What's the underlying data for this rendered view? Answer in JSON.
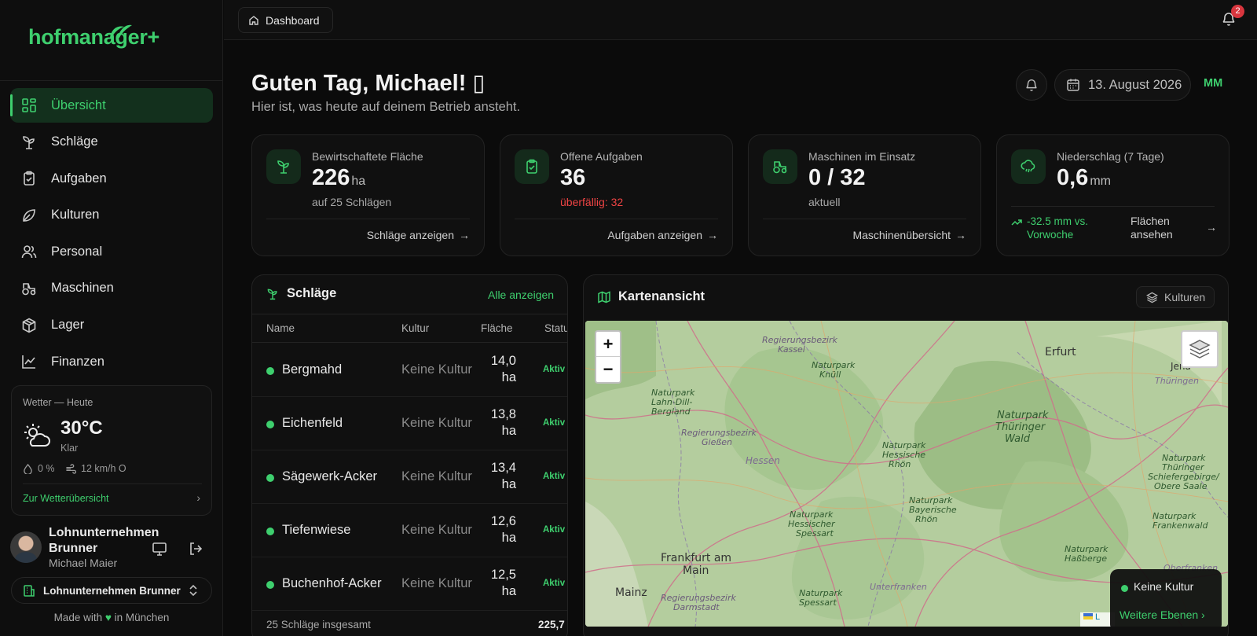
{
  "brand": {
    "name": "hofmanager+",
    "color": "#3ecf6e"
  },
  "nav": [
    {
      "label": "Übersicht",
      "icon": "grid-icon",
      "active": true
    },
    {
      "label": "Schläge",
      "icon": "sprout-icon"
    },
    {
      "label": "Aufgaben",
      "icon": "clipboard-icon"
    },
    {
      "label": "Kulturen",
      "icon": "leaf-icon"
    },
    {
      "label": "Personal",
      "icon": "users-icon"
    },
    {
      "label": "Maschinen",
      "icon": "tractor-icon"
    },
    {
      "label": "Lager",
      "icon": "package-icon"
    },
    {
      "label": "Finanzen",
      "icon": "chart-line-icon"
    }
  ],
  "weather": {
    "title": "Wetter — Heute",
    "temp": "30°C",
    "condition": "Klar",
    "rain": "0 %",
    "wind": "12 km/h O",
    "link": "Zur Wetterübersicht"
  },
  "user": {
    "org": "Lohnunternehmen Brunner",
    "name": "Michael Maier"
  },
  "org_switch": {
    "label": "Lohnunternehmen Brunner"
  },
  "footer": {
    "prefix": "Made with",
    "heart": "♥",
    "suffix": "in München"
  },
  "topbar": {
    "breadcrumb": "Dashboard",
    "notifications": "2"
  },
  "header": {
    "greeting": "Guten Tag, Michael! ",
    "greeting_glyph": "▯",
    "subtitle": "Hier ist, was heute auf deinem Betrieb ansteht.",
    "date": "13. August 2026",
    "initials": "MM"
  },
  "stats": [
    {
      "label": "Bewirtschaftete Fläche",
      "value": "226",
      "unit": "ha",
      "note": "auf 25 Schlägen",
      "link": "Schläge anzeigen",
      "icon": "sprout-icon"
    },
    {
      "label": "Offene Aufgaben",
      "value": "36",
      "unit": "",
      "note": "überfällig: 32",
      "link": "Aufgaben anzeigen",
      "icon": "clipboard-check-icon"
    },
    {
      "label": "Maschinen im Einsatz",
      "value": "0 / 32",
      "unit": "",
      "note": "aktuell",
      "link": "Maschinenübersicht",
      "icon": "tractor-icon"
    },
    {
      "label": "Niederschlag (7 Tage)",
      "value": "0,6",
      "unit": "mm",
      "note": "",
      "trend": "-32.5 mm vs. Vorwoche",
      "link": "Flächen ansehen",
      "icon": "cloud-rain-icon"
    }
  ],
  "fields": {
    "title": "Schläge",
    "all_link": "Alle anzeigen",
    "columns": [
      "Name",
      "Kultur",
      "Fläche",
      "Status"
    ],
    "rows": [
      {
        "name": "Bergmahd",
        "kultur": "Keine Kultur",
        "area": "14,0",
        "unit": "ha",
        "status": "Aktiv"
      },
      {
        "name": "Eichenfeld",
        "kultur": "Keine Kultur",
        "area": "13,8",
        "unit": "ha",
        "status": "Aktiv"
      },
      {
        "name": "Sägewerk-Acker",
        "kultur": "Keine Kultur",
        "area": "13,4",
        "unit": "ha",
        "status": "Aktiv"
      },
      {
        "name": "Tiefenwiese",
        "kultur": "Keine Kultur",
        "area": "12,6",
        "unit": "ha",
        "status": "Aktiv"
      },
      {
        "name": "Buchenhof-Acker",
        "kultur": "Keine Kultur",
        "area": "12,5",
        "unit": "ha",
        "status": "Aktiv"
      }
    ],
    "total_label": "25 Schläge insgesamt",
    "total_value": "225,7"
  },
  "map": {
    "title": "Kartenansicht",
    "layer_button": "Kulturen",
    "zoom_in": "+",
    "zoom_out": "−",
    "legend_item": "Keine Kultur",
    "legend_more": "Weitere Ebenen",
    "attribution": "L",
    "labels": [
      "Regierungsbezirk Kassel",
      "Erfurt",
      "Jena",
      "Thüringen",
      "Naturpark Knüll",
      "Naturpark Lahn-Dill-Bergland",
      "Regierungsbezirk Gießen",
      "Hessen",
      "Naturpark Hessische Rhön",
      "Naturpark Thüringer Wald",
      "Naturpark Thüringer Schiefergebirge/Obere Saale",
      "Naturpark Bayerische Rhön",
      "Naturpark Hessischer Spessart",
      "Naturpark Frankenwald",
      "Frankfurt am Main",
      "Mainz",
      "Regierungsbezirk Darmstadt",
      "Naturpark Spessart",
      "Naturpark Haßberge",
      "Unterfranken",
      "Oberfranken"
    ]
  }
}
